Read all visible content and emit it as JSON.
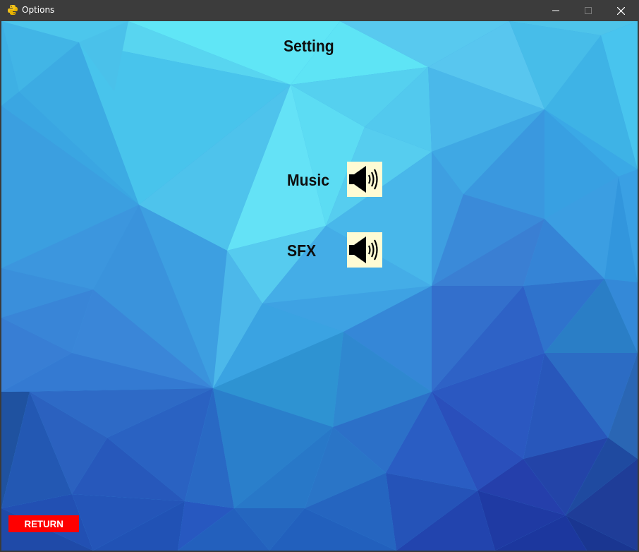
{
  "window": {
    "title": "Options",
    "controls": {
      "minimize_icon": "minimize-icon",
      "maximize_icon": "maximize-icon",
      "close_icon": "close-icon"
    }
  },
  "screen": {
    "heading": "Setting",
    "options": [
      {
        "label": "Music",
        "icon": "speaker-on-icon"
      },
      {
        "label": "SFX",
        "icon": "speaker-on-icon"
      }
    ],
    "return_label": "RETURN"
  },
  "colors": {
    "titlebar": "#3c3c3c",
    "speaker_bg": "#fffbd4",
    "return_bg": "#ff0000",
    "text": "#0e0e0e"
  }
}
